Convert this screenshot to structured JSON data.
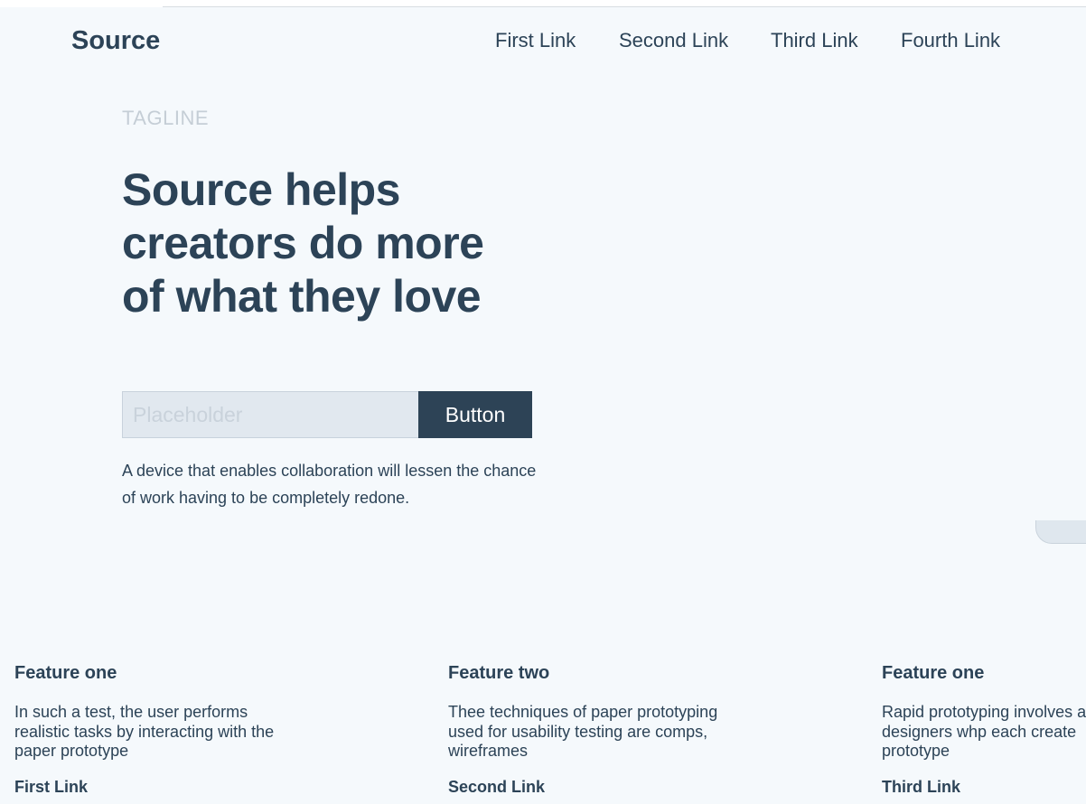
{
  "header": {
    "brand": "Source",
    "nav": [
      "First Link",
      "Second Link",
      "Third Link",
      "Fourth Link"
    ]
  },
  "hero": {
    "tagline": "TAGLINE",
    "headline_lines": [
      "Source helps",
      "creators do more",
      "of what they love"
    ],
    "input_placeholder": "Placeholder",
    "button_label": "Button",
    "description_lines": [
      "A device that enables collaboration will lessen the chance",
      "of work having to be completely redone."
    ]
  },
  "features": [
    {
      "title": "Feature one",
      "lines": [
        "In such a test, the user performs",
        "realistic tasks by interacting with the",
        "paper prototype"
      ],
      "link": "First Link"
    },
    {
      "title": "Feature two",
      "lines": [
        "Thee techniques of paper prototyping",
        "used for usability testing are comps,",
        "wireframes"
      ],
      "link": "Second Link"
    },
    {
      "title": "Feature one",
      "lines": [
        "Rapid prototyping involves a",
        "designers whp each create",
        "prototype"
      ],
      "link": "Third Link"
    }
  ],
  "colors": {
    "background": "#f5f9fc",
    "text": "#2c4357",
    "button": "#2d4356",
    "input_bg": "#e1e8ef",
    "muted": "#c5ced6"
  }
}
